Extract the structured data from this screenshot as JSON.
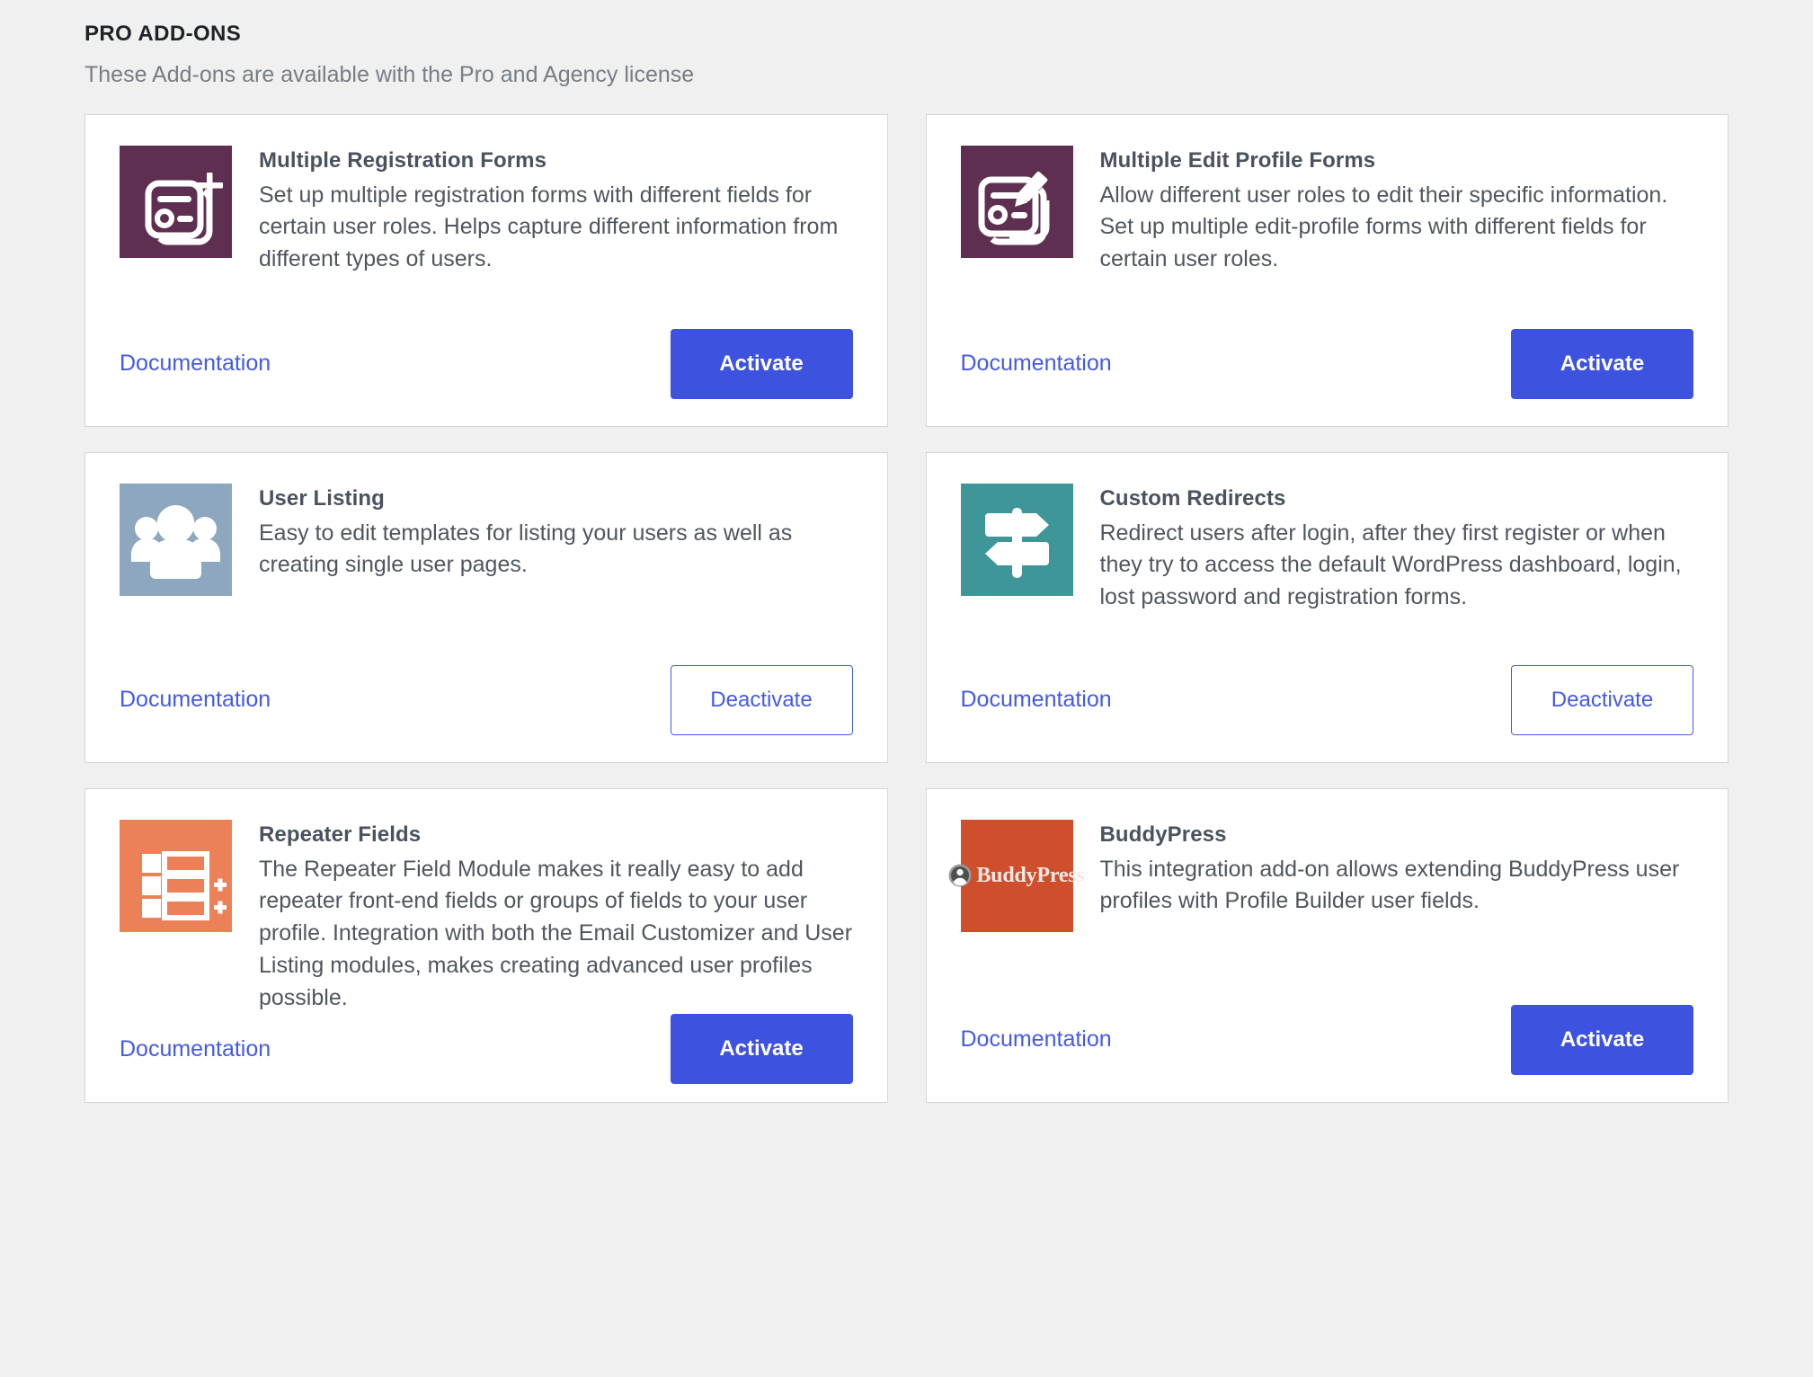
{
  "section": {
    "title": "PRO ADD-ONS",
    "subtitle": "These Add-ons are available with the Pro and Agency license"
  },
  "labels": {
    "documentation": "Documentation",
    "activate": "Activate",
    "deactivate": "Deactivate"
  },
  "colors": {
    "page_background": "#f0f0f0",
    "card_background": "#ffffff",
    "card_border": "#d5d5d5",
    "accent_blue": "#3d53e0",
    "link_blue": "#4459e8",
    "title_text": "#4a5260",
    "body_text": "#50565f",
    "heading_text": "#1d2327",
    "subtitle_text": "#777d83",
    "icon_purple": "#5e2f51",
    "icon_blue_grey": "#8ca7be",
    "icon_teal": "#3f9699",
    "icon_orange": "#ec8157",
    "icon_buddypress_bg": "#cf4f2c"
  },
  "addons": [
    {
      "id": "multiple-registration-forms",
      "title": "Multiple Registration Forms",
      "description": "Set up multiple registration forms with different fields for certain user roles. Helps capture different information from different types of users.",
      "icon": "form-plus-icon",
      "icon_bg": "#5e2f51",
      "doc_label": "Documentation",
      "action_label": "Activate",
      "action_state": "inactive"
    },
    {
      "id": "multiple-edit-profile-forms",
      "title": "Multiple Edit Profile Forms",
      "description": "Allow different user roles to edit their specific information. Set up multiple edit-profile forms with different fields for certain user roles.",
      "icon": "form-pencil-icon",
      "icon_bg": "#5e2f51",
      "doc_label": "Documentation",
      "action_label": "Activate",
      "action_state": "inactive"
    },
    {
      "id": "user-listing",
      "title": "User Listing",
      "description": "Easy to edit templates for listing your users as well as creating single user pages.",
      "icon": "users-group-icon",
      "icon_bg": "#8ca7be",
      "doc_label": "Documentation",
      "action_label": "Deactivate",
      "action_state": "active"
    },
    {
      "id": "custom-redirects",
      "title": "Custom Redirects",
      "description": "Redirect users after login, after they first register or when they try to access the default WordPress dashboard, login, lost password and registration forms.",
      "icon": "signpost-icon",
      "icon_bg": "#3f9699",
      "doc_label": "Documentation",
      "action_label": "Deactivate",
      "action_state": "active"
    },
    {
      "id": "repeater-fields",
      "title": "Repeater Fields",
      "description": "The Repeater Field Module makes it really easy to add repeater front-end fields or groups of fields to your user profile. Integration with both the Email Customizer and User Listing modules, makes creating advanced user profiles possible.",
      "icon": "repeater-rows-icon",
      "icon_bg": "#ec8157",
      "doc_label": "Documentation",
      "action_label": "Activate",
      "action_state": "inactive"
    },
    {
      "id": "buddypress",
      "title": "BuddyPress",
      "description": "This integration add-on allows extending BuddyPress user profiles with Profile Builder user fields.",
      "icon": "buddypress-logo-icon",
      "icon_bg": "#cf4f2c",
      "icon_wordmark": "BuddyPress",
      "doc_label": "Documentation",
      "action_label": "Activate",
      "action_state": "inactive"
    }
  ]
}
